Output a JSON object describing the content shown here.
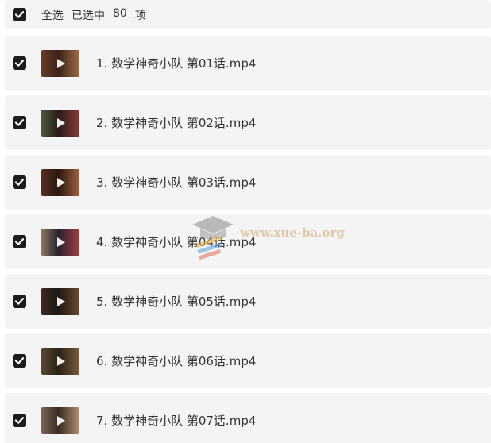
{
  "select_all": {
    "label": "全选",
    "selected_prefix": "已选中",
    "selected_count": "80",
    "selected_suffix": "项",
    "checked": true
  },
  "files": [
    {
      "name": "1. 数学神奇小队 第01话.mp4",
      "checked": true,
      "thumb_colors": [
        "#6b3a2a",
        "#3a2418",
        "#a06a46"
      ]
    },
    {
      "name": "2. 数学神奇小队 第02话.mp4",
      "checked": true,
      "thumb_colors": [
        "#4a5a3a",
        "#2a1c1a",
        "#8a3a32"
      ]
    },
    {
      "name": "3. 数学神奇小队 第03话.mp4",
      "checked": true,
      "thumb_colors": [
        "#5a2e22",
        "#2a1810",
        "#a0603e"
      ]
    },
    {
      "name": "4. 数学神奇小队 第04话.mp4",
      "checked": true,
      "thumb_colors": [
        "#8a7a60",
        "#2a2030",
        "#a04040"
      ]
    },
    {
      "name": "5. 数学神奇小队 第05话.mp4",
      "checked": true,
      "thumb_colors": [
        "#3a2a22",
        "#1e1814",
        "#6a4a30"
      ]
    },
    {
      "name": "6. 数学神奇小队 第06话.mp4",
      "checked": true,
      "thumb_colors": [
        "#5a4a30",
        "#2a2218",
        "#7a5a3a"
      ]
    },
    {
      "name": "7. 数学神奇小队 第07话.mp4",
      "checked": true,
      "thumb_colors": [
        "#7a6a58",
        "#3a2a22",
        "#b09070"
      ]
    }
  ],
  "watermark": {
    "url": "www.xue-ba.org",
    "icon": "graduation-cap-icon"
  }
}
